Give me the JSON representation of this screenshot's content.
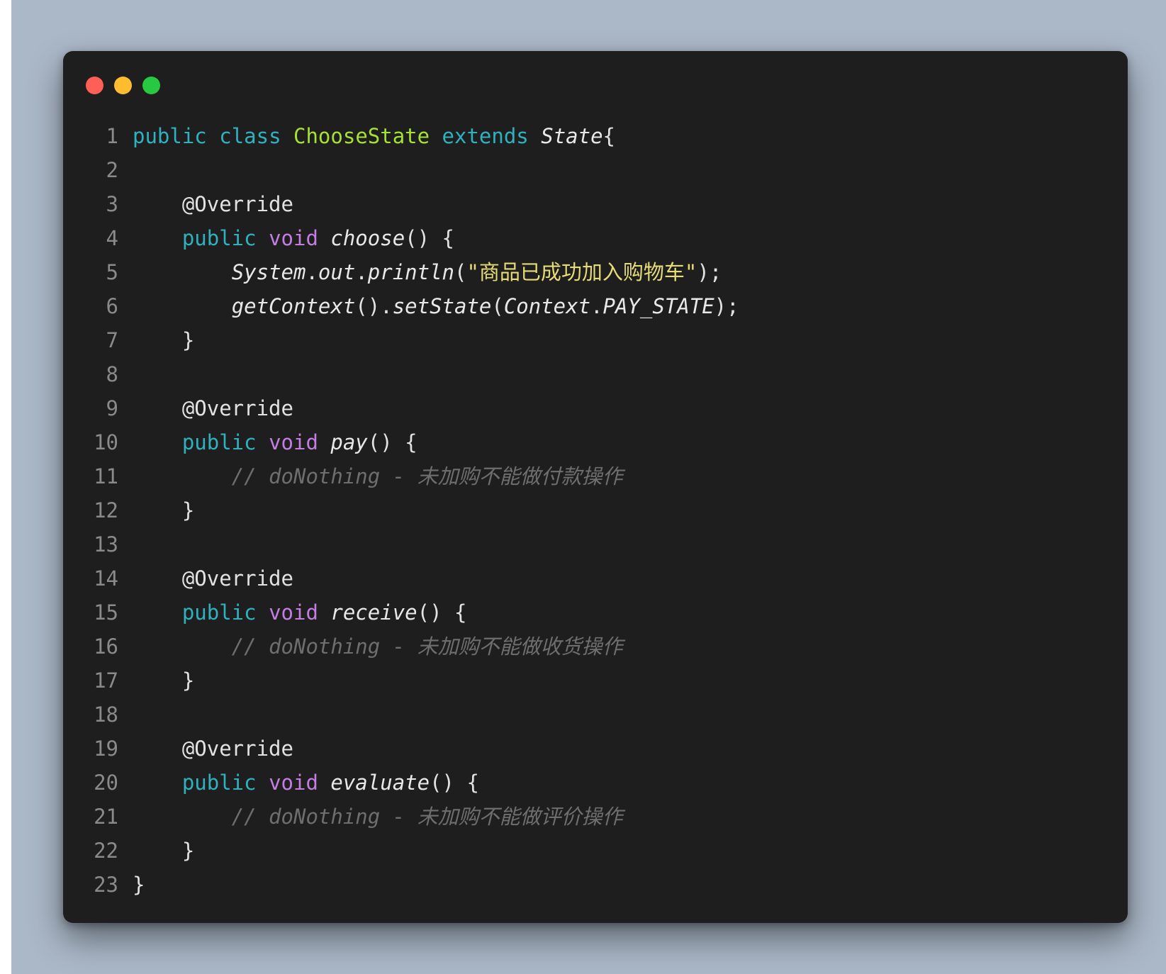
{
  "theme": {
    "background": "#abb8c8",
    "window": "#1e1e1e",
    "dot_red": "#ff5f57",
    "dot_yellow": "#febc2e",
    "dot_green": "#28c840",
    "keyword": "#2fb2c0",
    "type_keyword": "#c47de0",
    "class_name": "#a6e22e",
    "string": "#e6db74",
    "comment": "#6e6e6e"
  },
  "window_controls": [
    "close-dot",
    "minimize-dot",
    "maximize-dot"
  ],
  "code": {
    "lines": [
      {
        "n": "1",
        "tokens": [
          {
            "t": "public",
            "c": "kw"
          },
          {
            "t": " ",
            "c": ""
          },
          {
            "t": "class",
            "c": "kw"
          },
          {
            "t": " ",
            "c": ""
          },
          {
            "t": "ChooseState",
            "c": "cls"
          },
          {
            "t": " ",
            "c": ""
          },
          {
            "t": "extends",
            "c": "kw"
          },
          {
            "t": " ",
            "c": ""
          },
          {
            "t": "State",
            "c": "it"
          },
          {
            "t": "{",
            "c": ""
          }
        ]
      },
      {
        "n": "2",
        "tokens": []
      },
      {
        "n": "3",
        "tokens": [
          {
            "t": "    ",
            "c": ""
          },
          {
            "t": "@Override",
            "c": "ann"
          }
        ]
      },
      {
        "n": "4",
        "tokens": [
          {
            "t": "    ",
            "c": ""
          },
          {
            "t": "public",
            "c": "kw"
          },
          {
            "t": " ",
            "c": ""
          },
          {
            "t": "void",
            "c": "kw2"
          },
          {
            "t": " ",
            "c": ""
          },
          {
            "t": "choose",
            "c": "it"
          },
          {
            "t": "() {",
            "c": ""
          }
        ]
      },
      {
        "n": "5",
        "tokens": [
          {
            "t": "        ",
            "c": ""
          },
          {
            "t": "System",
            "c": "it"
          },
          {
            "t": ".",
            "c": ""
          },
          {
            "t": "out",
            "c": "it"
          },
          {
            "t": ".",
            "c": ""
          },
          {
            "t": "println",
            "c": "it"
          },
          {
            "t": "(",
            "c": ""
          },
          {
            "t": "\"商品已成功加入购物车\"",
            "c": "str"
          },
          {
            "t": ");",
            "c": ""
          }
        ]
      },
      {
        "n": "6",
        "tokens": [
          {
            "t": "        ",
            "c": ""
          },
          {
            "t": "getContext",
            "c": "it"
          },
          {
            "t": "().",
            "c": ""
          },
          {
            "t": "setState",
            "c": "it"
          },
          {
            "t": "(",
            "c": ""
          },
          {
            "t": "Context",
            "c": "it"
          },
          {
            "t": ".",
            "c": ""
          },
          {
            "t": "PAY_STATE",
            "c": "it"
          },
          {
            "t": ");",
            "c": ""
          }
        ]
      },
      {
        "n": "7",
        "tokens": [
          {
            "t": "    }",
            "c": ""
          }
        ]
      },
      {
        "n": "8",
        "tokens": []
      },
      {
        "n": "9",
        "tokens": [
          {
            "t": "    ",
            "c": ""
          },
          {
            "t": "@Override",
            "c": "ann"
          }
        ]
      },
      {
        "n": "10",
        "tokens": [
          {
            "t": "    ",
            "c": ""
          },
          {
            "t": "public",
            "c": "kw"
          },
          {
            "t": " ",
            "c": ""
          },
          {
            "t": "void",
            "c": "kw2"
          },
          {
            "t": " ",
            "c": ""
          },
          {
            "t": "pay",
            "c": "it"
          },
          {
            "t": "() {",
            "c": ""
          }
        ]
      },
      {
        "n": "11",
        "tokens": [
          {
            "t": "        ",
            "c": ""
          },
          {
            "t": "// doNothing - 未加购不能做付款操作",
            "c": "cmt"
          }
        ]
      },
      {
        "n": "12",
        "tokens": [
          {
            "t": "    }",
            "c": ""
          }
        ]
      },
      {
        "n": "13",
        "tokens": []
      },
      {
        "n": "14",
        "tokens": [
          {
            "t": "    ",
            "c": ""
          },
          {
            "t": "@Override",
            "c": "ann"
          }
        ]
      },
      {
        "n": "15",
        "tokens": [
          {
            "t": "    ",
            "c": ""
          },
          {
            "t": "public",
            "c": "kw"
          },
          {
            "t": " ",
            "c": ""
          },
          {
            "t": "void",
            "c": "kw2"
          },
          {
            "t": " ",
            "c": ""
          },
          {
            "t": "receive",
            "c": "it"
          },
          {
            "t": "() {",
            "c": ""
          }
        ]
      },
      {
        "n": "16",
        "tokens": [
          {
            "t": "        ",
            "c": ""
          },
          {
            "t": "// doNothing - 未加购不能做收货操作",
            "c": "cmt"
          }
        ]
      },
      {
        "n": "17",
        "tokens": [
          {
            "t": "    }",
            "c": ""
          }
        ]
      },
      {
        "n": "18",
        "tokens": []
      },
      {
        "n": "19",
        "tokens": [
          {
            "t": "    ",
            "c": ""
          },
          {
            "t": "@Override",
            "c": "ann"
          }
        ]
      },
      {
        "n": "20",
        "tokens": [
          {
            "t": "    ",
            "c": ""
          },
          {
            "t": "public",
            "c": "kw"
          },
          {
            "t": " ",
            "c": ""
          },
          {
            "t": "void",
            "c": "kw2"
          },
          {
            "t": " ",
            "c": ""
          },
          {
            "t": "evaluate",
            "c": "it"
          },
          {
            "t": "() {",
            "c": ""
          }
        ]
      },
      {
        "n": "21",
        "tokens": [
          {
            "t": "        ",
            "c": ""
          },
          {
            "t": "// doNothing - 未加购不能做评价操作",
            "c": "cmt"
          }
        ]
      },
      {
        "n": "22",
        "tokens": [
          {
            "t": "    }",
            "c": ""
          }
        ]
      },
      {
        "n": "23",
        "tokens": [
          {
            "t": "}",
            "c": ""
          }
        ]
      }
    ]
  }
}
